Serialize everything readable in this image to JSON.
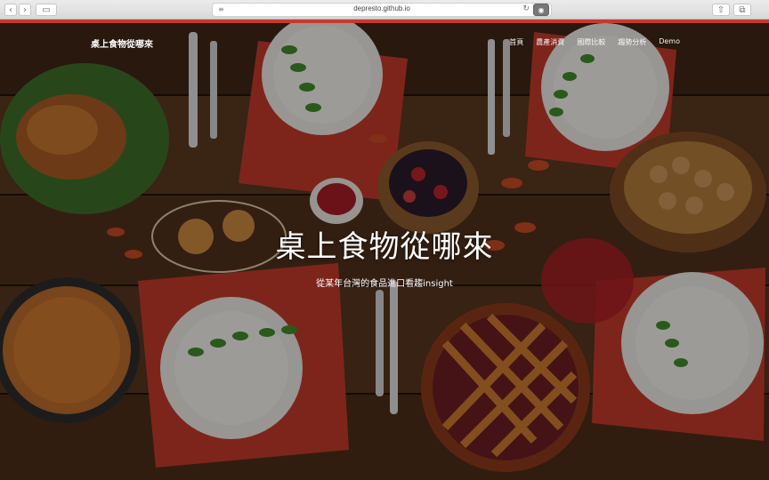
{
  "browser": {
    "url": "depresto.github.io",
    "back_glyph": "‹",
    "forward_glyph": "›",
    "sidebar_glyph": "▭",
    "reload_glyph": "↻",
    "share_glyph": "⇧",
    "tabs_glyph": "⧉"
  },
  "site": {
    "brand": "桌上食物從哪來",
    "nav": [
      "首頁",
      "農產消費",
      "國際比較",
      "趨勢分析",
      "Demo"
    ]
  },
  "hero": {
    "title": "桌上食物從哪來",
    "subtitle": "從某年台灣的食品進口看趨insight"
  },
  "colors": {
    "accent": "#c8392b",
    "wood": "#4a2d19"
  }
}
